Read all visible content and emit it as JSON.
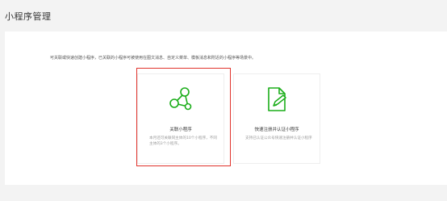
{
  "page": {
    "title": "小程序管理"
  },
  "panel": {
    "description": "可关联或快速创建小程序，已关联的小程序可被使用在图文消息、自定义菜单、模板消息和附近的小程序等场景中。"
  },
  "cards": [
    {
      "title": "关联小程序",
      "description": "本月还可关联同主体的10个小程序，不同主体的3个小程序。",
      "icon": "share-nodes-icon"
    },
    {
      "title": "快速注册并认证小程序",
      "description": "支持已认证公众号快速注册并认证小程序",
      "icon": "document-edit-icon"
    }
  ],
  "colors": {
    "accent": "#1aad19",
    "highlight": "#e0322b"
  }
}
